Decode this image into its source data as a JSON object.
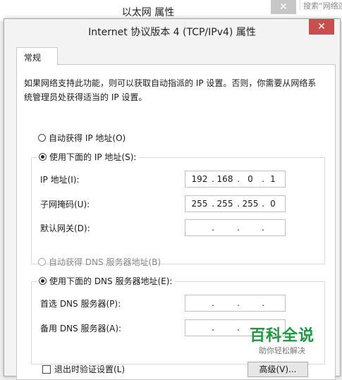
{
  "background_window": {
    "title": "以太网 属性",
    "close_label": "✕",
    "search_text": "搜索“网络连"
  },
  "dialog": {
    "title": "Internet 协议版本 4 (TCP/IPv4) 属性",
    "close_label": "✕",
    "tab_general": "常规",
    "description": "如果网络支持此功能，则可以获取自动指派的 IP 设置。否则，你需要从网络系统管理员处获得适当的 IP 设置。",
    "ip_auto_label": "自动获得 IP 地址(O)",
    "ip_manual_label": "使用下面的 IP 地址(S):",
    "ip_address_label": "IP 地址(I):",
    "ip_address": [
      "192",
      "168",
      "0",
      "1"
    ],
    "subnet_mask_label": "子网掩码(U):",
    "subnet_mask": [
      "255",
      "255",
      "255",
      "0"
    ],
    "gateway_label": "默认网关(D):",
    "gateway": [
      "",
      "",
      "",
      ""
    ],
    "dns_auto_label": "自动获得 DNS 服务器地址(B)",
    "dns_manual_label": "使用下面的 DNS 服务器地址(E):",
    "dns_preferred_label": "首选 DNS 服务器(P):",
    "dns_preferred": [
      "",
      "",
      "",
      ""
    ],
    "dns_alternate_label": "备用 DNS 服务器(A):",
    "dns_alternate": [
      "",
      "",
      "",
      ""
    ],
    "validate_on_exit_label": "退出时验证设置(L)",
    "advanced_button": "高级(V)..."
  },
  "watermark": {
    "main": "百科全说",
    "sub": "助你轻松解决"
  },
  "colors": {
    "watermark_green": "#1d9b3c",
    "dialog_close_red": "#c94f4f"
  }
}
